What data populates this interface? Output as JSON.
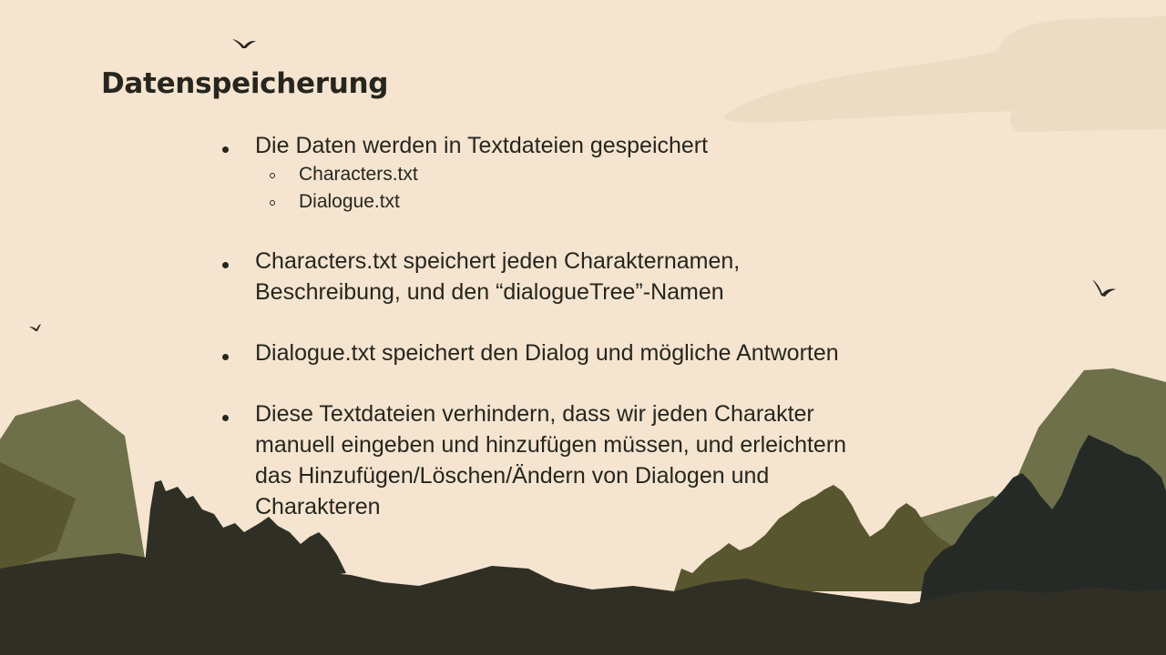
{
  "slide": {
    "title": "Datenspeicherung",
    "bullets": [
      {
        "text": "Die Daten werden in Textdateien gespeichert",
        "sub": [
          "Characters.txt",
          "Dialogue.txt"
        ]
      },
      {
        "lines": [
          "Characters.txt speichert jeden Charakternamen,",
          "Beschreibung, und den “dialogueTree”-Namen"
        ]
      },
      {
        "text": "Dialogue.txt speichert den Dialog und mögliche Antworten"
      },
      {
        "lines": [
          "Diese Textdateien verhindern, dass wir jeden Charakter",
          "manuell eingeben und hinzufügen müssen, und erleichtern",
          "das Hinzufügen/Löschen/Ändern von Dialogen und",
          "Charakteren"
        ]
      }
    ]
  },
  "colors": {
    "background": "#f5e4cf",
    "cloud": "#ecdcc3",
    "hill_green": "#6d7049",
    "hill_olive": "#57562f",
    "forest_dark": "#2f2f26",
    "forest_charcoal": "#252a27",
    "text": "#26261f"
  },
  "icons": [
    "bird-icon"
  ]
}
